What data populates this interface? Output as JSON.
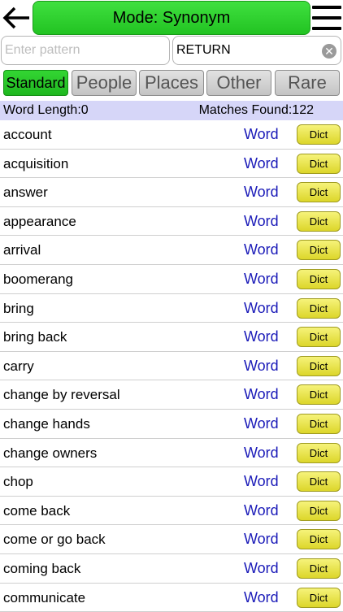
{
  "header": {
    "title": "Mode: Synonym"
  },
  "search": {
    "pattern_placeholder": "Enter pattern",
    "pattern_value": "",
    "word_value": "RETURN"
  },
  "tabs": [
    {
      "label": "Standard",
      "active": true
    },
    {
      "label": "People"
    },
    {
      "label": "Places"
    },
    {
      "label": "Other"
    },
    {
      "label": "Rare"
    }
  ],
  "status": {
    "word_length": "Word Length:0",
    "matches": "Matches Found:122"
  },
  "list": {
    "type_label": "Word",
    "dict_label": "Dict",
    "words": [
      "account",
      "acquisition",
      "answer",
      "appearance",
      "arrival",
      "boomerang",
      "bring",
      "bring back",
      "carry",
      "change by reversal",
      "change hands",
      "change owners",
      "chop",
      "come back",
      "come or go back",
      "coming back",
      "communicate"
    ]
  },
  "colors": {
    "accent_green": "#22c322",
    "dict_yellow": "#e6e03a",
    "info_bar": "#d6d6f8",
    "word_blue": "#1a1ab8"
  }
}
